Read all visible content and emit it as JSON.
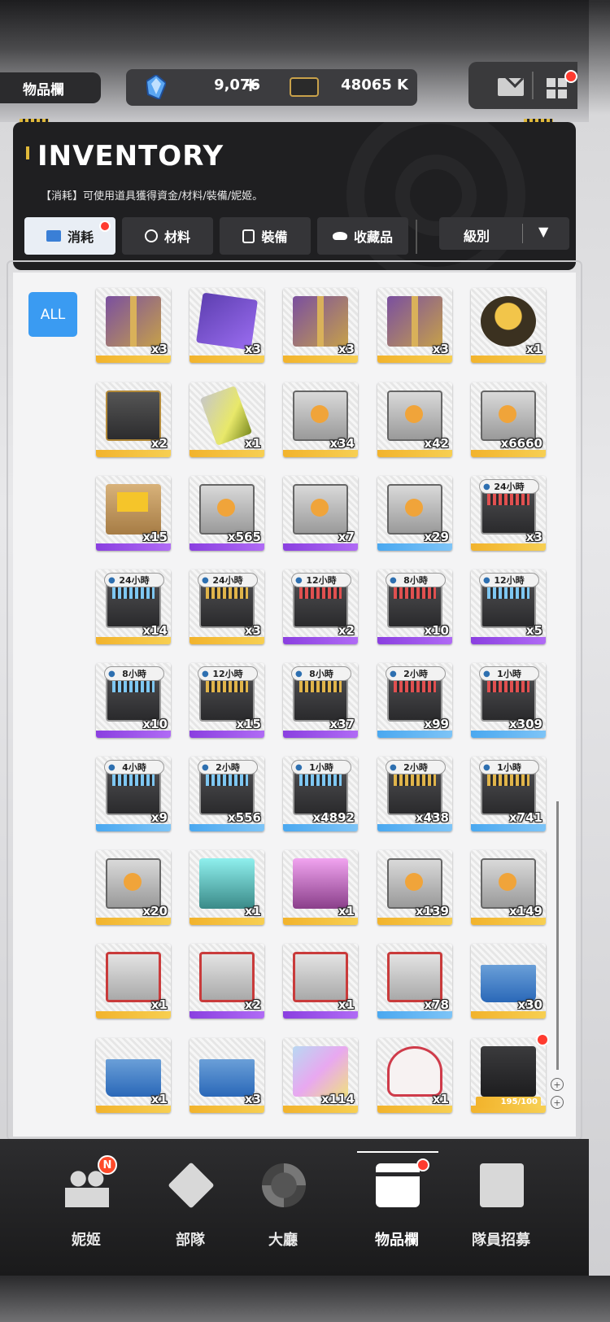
{
  "header": {
    "page_tag": "物品欄",
    "crystal_icon": "crystal-icon",
    "currency1": "9,076",
    "currency1_plus": "+",
    "ticket_icon": "ticket-icon",
    "currency2": "48065 K",
    "mail_icon": "mail-icon",
    "menu_icon": "grid-menu-icon"
  },
  "panel": {
    "title": "INVENTORY",
    "description": "【消耗】可使用道具獲得資金/材料/裝備/妮姬。",
    "tabs": [
      {
        "label": "消耗",
        "icon": "consumable-icon",
        "active": true,
        "dot": true
      },
      {
        "label": "材料",
        "icon": "material-icon",
        "active": false
      },
      {
        "label": "裝備",
        "icon": "equipment-icon",
        "active": false
      },
      {
        "label": "收藏品",
        "icon": "collectible-icon",
        "active": false
      }
    ],
    "sort": {
      "label": "級別",
      "arrow": "▼"
    }
  },
  "filter_all": "ALL",
  "items": [
    {
      "art": "gift",
      "rarity": "gold",
      "qty": "x3",
      "time": ""
    },
    {
      "art": "purplecube",
      "rarity": "gold",
      "qty": "x3",
      "time": ""
    },
    {
      "art": "gift",
      "rarity": "gold",
      "qty": "x3",
      "time": ""
    },
    {
      "art": "gift",
      "rarity": "gold",
      "qty": "x3",
      "time": ""
    },
    {
      "art": "trophy",
      "rarity": "gold",
      "qty": "x1",
      "time": ""
    },
    {
      "art": "darkcrate",
      "rarity": "gold",
      "qty": "x2",
      "time": ""
    },
    {
      "art": "battery",
      "rarity": "gold",
      "qty": "x1",
      "time": ""
    },
    {
      "art": "crate",
      "rarity": "gold",
      "qty": "x34",
      "time": ""
    },
    {
      "art": "crate",
      "rarity": "gold",
      "qty": "x42",
      "time": ""
    },
    {
      "art": "crate",
      "rarity": "gold",
      "qty": "x6660",
      "time": ""
    },
    {
      "art": "cardbox",
      "rarity": "purple",
      "qty": "x15",
      "time": ""
    },
    {
      "art": "crate",
      "rarity": "purple",
      "qty": "x565",
      "time": ""
    },
    {
      "art": "crate",
      "rarity": "purple",
      "qty": "x7",
      "time": ""
    },
    {
      "art": "crate",
      "rarity": "blue",
      "qty": "x29",
      "time": ""
    },
    {
      "art": "case red",
      "rarity": "gold",
      "qty": "x3",
      "time": "24小時"
    },
    {
      "art": "case",
      "rarity": "gold",
      "qty": "x14",
      "time": "24小時"
    },
    {
      "art": "case gold",
      "rarity": "gold",
      "qty": "x3",
      "time": "24小時"
    },
    {
      "art": "case red",
      "rarity": "purple",
      "qty": "x2",
      "time": "12小時"
    },
    {
      "art": "case red",
      "rarity": "purple",
      "qty": "x10",
      "time": "8小時"
    },
    {
      "art": "case",
      "rarity": "purple",
      "qty": "x5",
      "time": "12小時"
    },
    {
      "art": "case",
      "rarity": "purple",
      "qty": "x10",
      "time": "8小時"
    },
    {
      "art": "case gold",
      "rarity": "purple",
      "qty": "x15",
      "time": "12小時"
    },
    {
      "art": "case gold",
      "rarity": "purple",
      "qty": "x37",
      "time": "8小時"
    },
    {
      "art": "case red",
      "rarity": "blue",
      "qty": "x99",
      "time": "2小時"
    },
    {
      "art": "case red",
      "rarity": "blue",
      "qty": "x309",
      "time": "1小時"
    },
    {
      "art": "case",
      "rarity": "blue",
      "qty": "x9",
      "time": "4小時"
    },
    {
      "art": "case",
      "rarity": "blue",
      "qty": "x556",
      "time": "2小時"
    },
    {
      "art": "case",
      "rarity": "blue",
      "qty": "x4892",
      "time": "1小時"
    },
    {
      "art": "case gold",
      "rarity": "blue",
      "qty": "x438",
      "time": "2小時"
    },
    {
      "art": "case gold",
      "rarity": "blue",
      "qty": "x741",
      "time": "1小時"
    },
    {
      "art": "crate",
      "rarity": "gold",
      "qty": "x20",
      "time": ""
    },
    {
      "art": "cyan",
      "rarity": "gold",
      "qty": "x1",
      "time": ""
    },
    {
      "art": "pink",
      "rarity": "gold",
      "qty": "x1",
      "time": ""
    },
    {
      "art": "crate",
      "rarity": "gold",
      "qty": "x139",
      "time": ""
    },
    {
      "art": "crate",
      "rarity": "gold",
      "qty": "x149",
      "time": ""
    },
    {
      "art": "redbox",
      "rarity": "gold",
      "qty": "x1",
      "time": ""
    },
    {
      "art": "redbox",
      "rarity": "purple",
      "qty": "x2",
      "time": ""
    },
    {
      "art": "redbox",
      "rarity": "purple",
      "qty": "x1",
      "time": ""
    },
    {
      "art": "redbox",
      "rarity": "blue",
      "qty": "x78",
      "time": ""
    },
    {
      "art": "basket",
      "rarity": "gold",
      "qty": "x30",
      "time": ""
    },
    {
      "art": "basket",
      "rarity": "gold",
      "qty": "x1",
      "time": ""
    },
    {
      "art": "basket",
      "rarity": "gold",
      "qty": "x3",
      "time": ""
    },
    {
      "art": "iridescent",
      "rarity": "gold",
      "qty": "x114",
      "time": ""
    },
    {
      "art": "heart",
      "rarity": "gold",
      "qty": "x1",
      "time": ""
    },
    {
      "art": "special",
      "rarity": "gold",
      "qty": "",
      "time": "",
      "progress_text": "195/100",
      "progress": 1.0,
      "dot": true
    }
  ],
  "scroll_buttons": [
    "up-scroll-icon",
    "down-scroll-icon"
  ],
  "nav": [
    {
      "label": "妮姬",
      "icon": "nikke-icon",
      "badge": "N"
    },
    {
      "label": "部隊",
      "icon": "squad-icon"
    },
    {
      "label": "大廳",
      "icon": "lobby-icon"
    },
    {
      "label": "物品欄",
      "icon": "inventory-icon",
      "active": true,
      "dot": true
    },
    {
      "label": "隊員招募",
      "icon": "recruit-icon"
    }
  ],
  "colors": {
    "accent_blue": "#3a9bf2",
    "rarity_gold": "#f2b32c",
    "rarity_purple": "#8a3fe0",
    "rarity_blue": "#4aa8f0",
    "alert_red": "#ff3b2f"
  }
}
